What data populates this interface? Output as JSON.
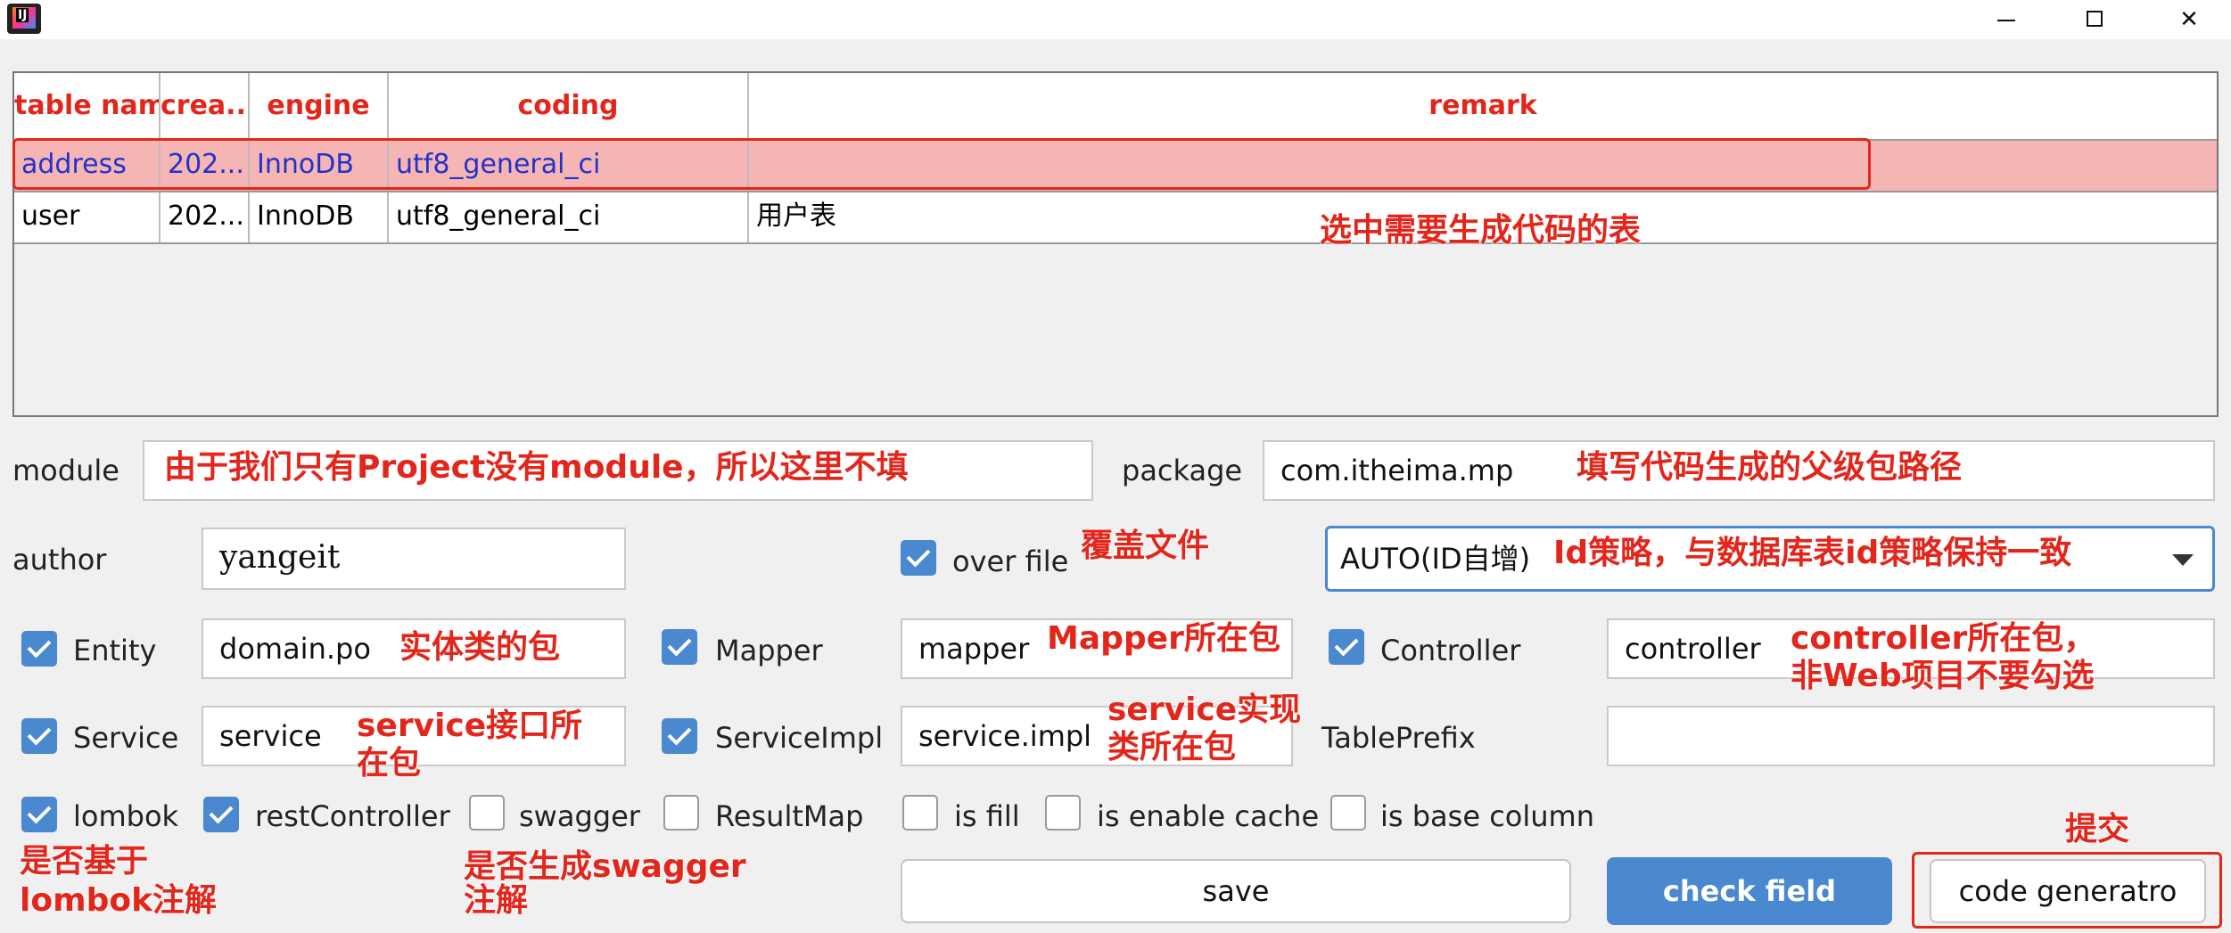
{
  "table": {
    "headers": [
      "table name",
      "crea...",
      "engine",
      "coding",
      "remark"
    ],
    "rows": [
      {
        "name": "address",
        "created": "202...",
        "engine": "InnoDB",
        "coding": "utf8_general_ci",
        "remark": ""
      },
      {
        "name": "user",
        "created": "202...",
        "engine": "InnoDB",
        "coding": "utf8_general_ci",
        "remark": "用户表"
      }
    ]
  },
  "form": {
    "module_label": "module",
    "module_value": "",
    "package_label": "package",
    "package_value": "com.itheima.mp",
    "author_label": "author",
    "author_value": "yangeit",
    "over_file_label": "over file",
    "id_strategy_value": "AUTO(ID自增)",
    "entity_label": "Entity",
    "entity_value": "domain.po",
    "mapper_label": "Mapper",
    "mapper_value": "mapper",
    "controller_label": "Controller",
    "controller_value": "controller",
    "service_label": "Service",
    "service_value": "service",
    "serviceimpl_label": "ServiceImpl",
    "serviceimpl_value": "service.impl",
    "tableprefix_label": "TablePrefix",
    "tableprefix_value": "",
    "lombok_label": "lombok",
    "restcontroller_label": "restController",
    "swagger_label": "swagger",
    "resultmap_label": "ResultMap",
    "isfill_label": "is fill",
    "enablecache_label": "is enable cache",
    "basecolumn_label": "is base column"
  },
  "checks": {
    "over_file": true,
    "entity": true,
    "mapper": true,
    "controller": true,
    "service": true,
    "serviceimpl": true,
    "lombok": true,
    "restcontroller": true,
    "swagger": false,
    "resultmap": false,
    "isfill": false,
    "enablecache": false,
    "basecolumn": false
  },
  "buttons": {
    "save": "save",
    "check_field": "check field",
    "code_generatro": "code generatro"
  },
  "annotations": {
    "select_table": "选中需要生成代码的表",
    "module": "由于我们只有Project没有module，所以这里不填",
    "package": "填写代码生成的父级包路径",
    "over_file": "覆盖文件",
    "id_strategy": "Id策略，与数据库表id策略保持一致",
    "entity": "实体类的包",
    "mapper": "Mapper所在包",
    "controller_1": "controller所在包，",
    "controller_2": "非Web项目不要勾选",
    "service_1": "service接口所",
    "service_2": "在包",
    "serviceimpl_1": "service实现",
    "serviceimpl_2": "类所在包",
    "submit": "提交",
    "lombok_1": "是否基于",
    "lombok_2": "lombok注解",
    "swagger_1": "是否生成swagger",
    "swagger_2": "注解"
  },
  "colors": {
    "accent": "#4a88d0",
    "annotation": "#e3261b",
    "selected_row": "#f5b5b5"
  }
}
